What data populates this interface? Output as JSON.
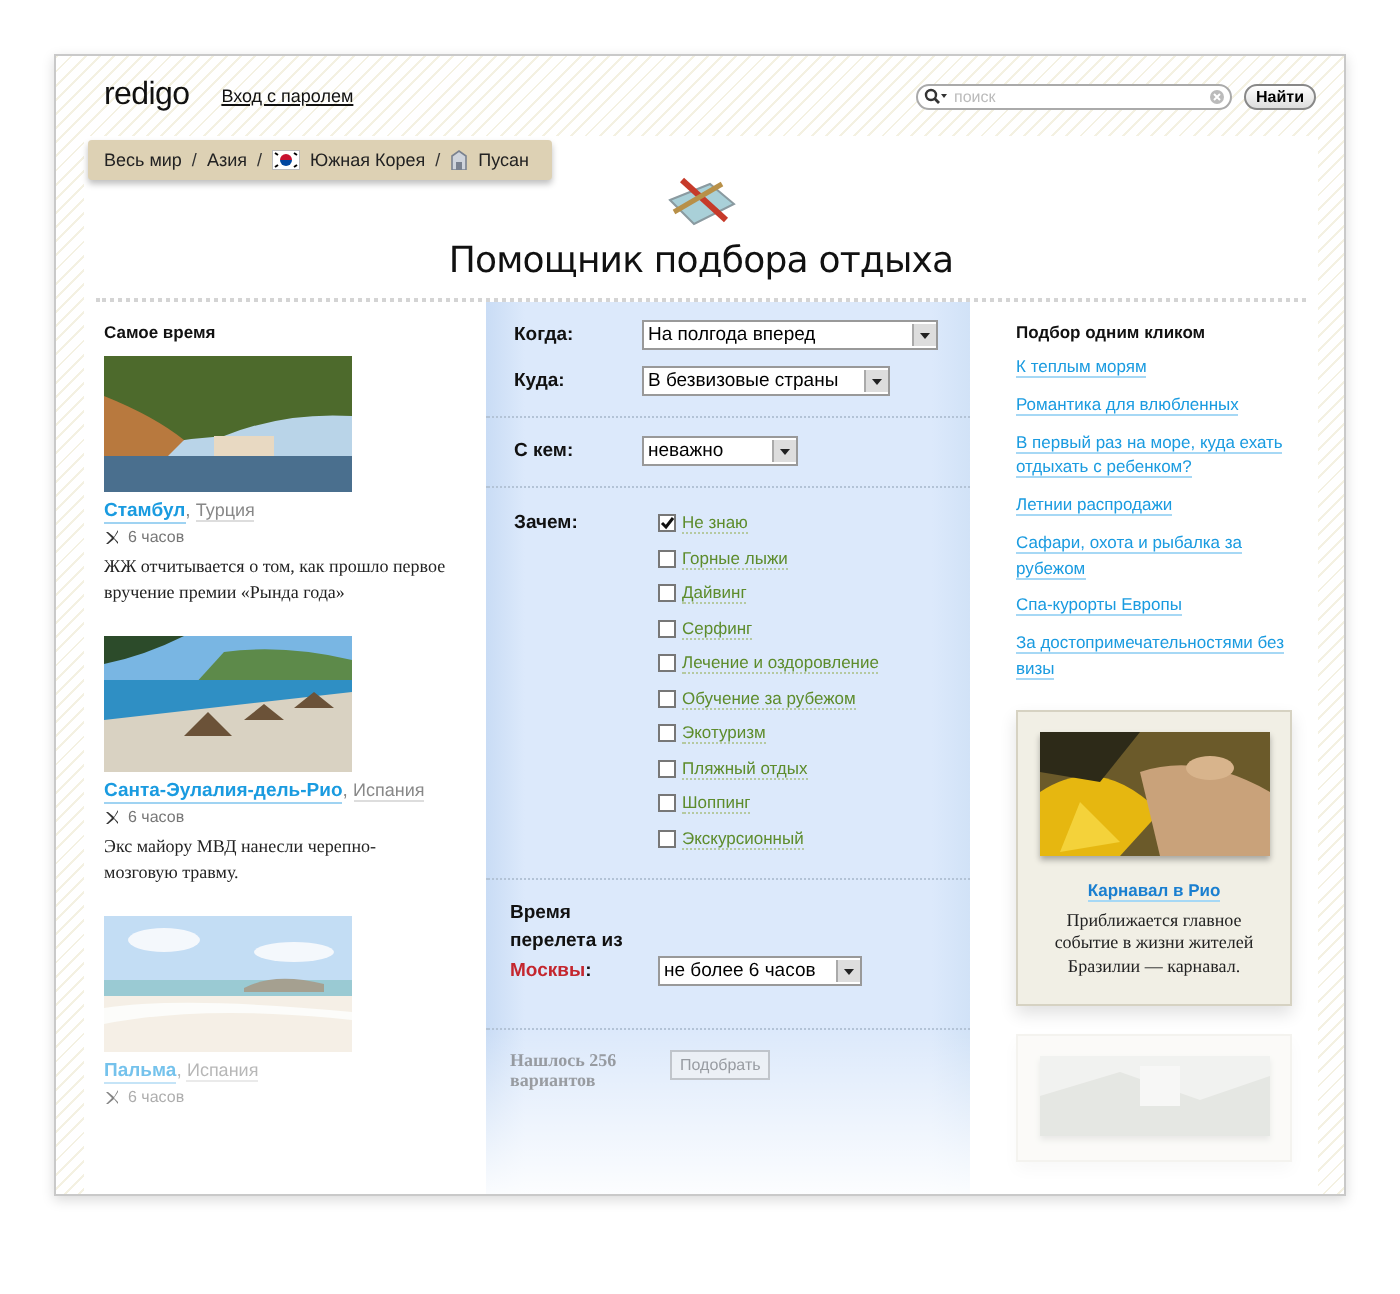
{
  "header": {
    "logo": "redigo",
    "login_link": "Вход с паролем",
    "search": {
      "placeholder": "поиск"
    },
    "search_button": "Найти"
  },
  "breadcrumbs": [
    {
      "label": "Весь мир",
      "kind": "plain"
    },
    {
      "label": "Азия",
      "kind": "plain"
    },
    {
      "label": "Южная Корея",
      "kind": "flag"
    },
    {
      "label": "Пусан",
      "kind": "building"
    }
  ],
  "breadcrumb_separator": "/",
  "title": "Помощник подбора отдыха",
  "left": {
    "heading": "Самое время",
    "city_separator": ",",
    "articles": [
      {
        "city": "Стамбул",
        "country": "Турция",
        "flight_time": "6 часов",
        "text": "ЖЖ отчитывается о том, как прошло первое вручение премии «Рында года»",
        "faded": false
      },
      {
        "city": "Санта-Эулалия-дель-Рио",
        "country": "Испания",
        "flight_time": "6 часов",
        "text": "Экс майору МВД нанесли черепно-мозговую травму.",
        "faded": false
      },
      {
        "city": "Пальма",
        "country": "Испания",
        "flight_time": "6 часов",
        "faded": true
      }
    ]
  },
  "form": {
    "select_groups": [
      [
        {
          "label": "Когда:",
          "value": "На полгода вперед"
        },
        {
          "label": "Куда:",
          "value": "В безвизовые страны"
        }
      ],
      [
        {
          "label": "С кем:",
          "value": "неважно"
        }
      ]
    ],
    "purpose_label": "Зачем:",
    "purposes": [
      {
        "label": "Не знаю",
        "checked": true
      },
      {
        "label": "Горные лыжи",
        "checked": false
      },
      {
        "label": "Дайвинг",
        "checked": false
      },
      {
        "label": "Серфинг",
        "checked": false
      },
      {
        "label": "Лечение и оздоровление",
        "checked": false
      },
      {
        "label": "Обучение за рубежом",
        "checked": false
      },
      {
        "label": "Экотуризм",
        "checked": false
      },
      {
        "label": "Пляжный отдых",
        "checked": false
      },
      {
        "label": "Шоппинг",
        "checked": false
      },
      {
        "label": "Экскурсионный",
        "checked": false
      }
    ],
    "flight": {
      "label": "Время перелета из",
      "city": "Москвы",
      "suffix": ":",
      "value": "не более 6 часов"
    },
    "result": {
      "text": "Нашлось 256 вариантов",
      "button": "Подобрать",
      "faded": true
    }
  },
  "right": {
    "heading": "Подбор одним кликом",
    "links": [
      "К теплым морям",
      "Романтика для влюбленных",
      "В первый раз на море, куда ехать отдыхать с ребенком?",
      "Летнии распродажи",
      "Сафари, охота и рыбалка за рубежом",
      "Спа-курорты Европы",
      "За достопримечательностями без визы"
    ],
    "promos": [
      {
        "kind": "card",
        "title": "Карнавал в Рио",
        "text": "Приближается главное событие в жизни жителей Бразилии — карнавал.",
        "faded": false
      },
      {
        "kind": "picture",
        "faded": true
      }
    ]
  }
}
